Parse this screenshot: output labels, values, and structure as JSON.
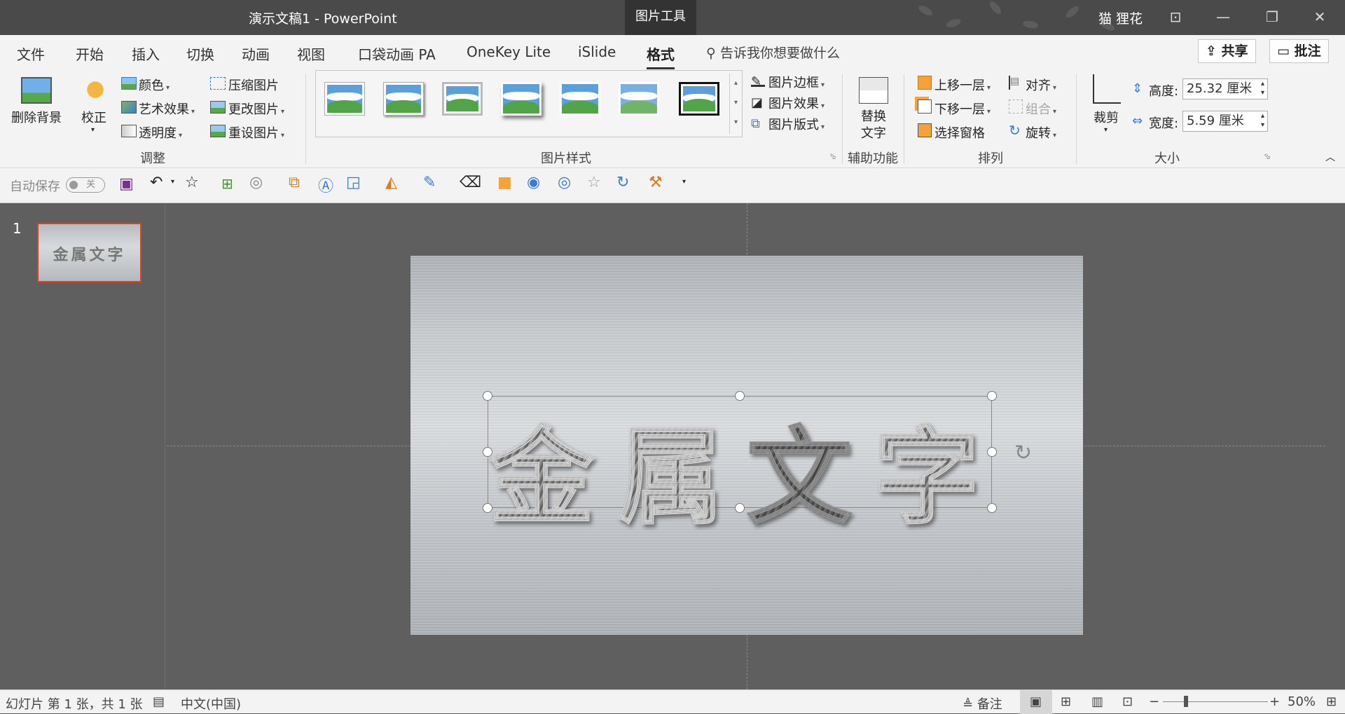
{
  "titlebar": {
    "doc_title": "演示文稿1  -  PowerPoint",
    "context_tab": "图片工具",
    "user": "猫 狸花"
  },
  "tabs": [
    "文件",
    "开始",
    "插入",
    "切换",
    "动画",
    "视图",
    "口袋动画 PA",
    "OneKey Lite",
    "iSlide",
    "格式"
  ],
  "active_tab": "格式",
  "tell_me": "告诉我你想要做什么",
  "share_label": "共享",
  "comment_label": "批注",
  "ribbon": {
    "remove_bg": "删除背景",
    "correct": "校正",
    "color": "颜色",
    "artistic": "艺术效果",
    "transparency": "透明度",
    "compress": "压缩图片",
    "change": "更改图片",
    "reset": "重设图片",
    "group_adjust": "调整",
    "group_styles": "图片样式",
    "border": "图片边框",
    "effects": "图片效果",
    "layout": "图片版式",
    "alt_text_1": "替换",
    "alt_text_2": "文字",
    "group_access": "辅助功能",
    "bring_fwd": "上移一层",
    "send_back": "下移一层",
    "sel_pane": "选择窗格",
    "align": "对齐",
    "group_btn": "组合",
    "rotate": "旋转",
    "group_arrange": "排列",
    "crop": "裁剪",
    "height_label": "高度:",
    "height_value": "25.32 厘米",
    "width_label": "宽度:",
    "width_value": "5.59 厘米",
    "group_size": "大小"
  },
  "qat": {
    "autosave": "自动保存",
    "toggle": "关"
  },
  "slides": {
    "number": "1",
    "thumb_text": "金属文字"
  },
  "slide_text": [
    "金",
    "属",
    "文",
    "字"
  ],
  "status": {
    "slide_info": "幻灯片 第 1 张，共 1 张",
    "language": "中文(中国)",
    "notes": "备注",
    "zoom": "50%"
  }
}
